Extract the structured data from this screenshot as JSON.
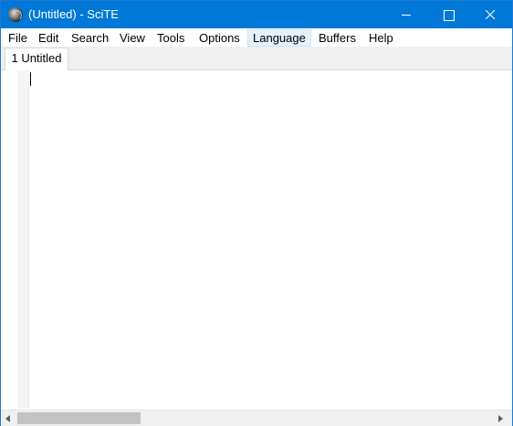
{
  "window": {
    "title": "(Untitled) - SciTE"
  },
  "menu": {
    "items": [
      "File",
      "Edit",
      "Search",
      "View",
      "Tools",
      "Options",
      "Language",
      "Buffers",
      "Help"
    ],
    "highlighted": "Language"
  },
  "tabs": [
    {
      "label": "1 Untitled",
      "active": true
    }
  ],
  "editor": {
    "content": ""
  },
  "icons": {
    "app": "scite-icon",
    "minimize": "minimize-icon",
    "maximize": "maximize-icon",
    "close": "close-icon",
    "scroll_left": "arrow-left-icon",
    "scroll_right": "arrow-right-icon"
  },
  "colors": {
    "titlebar": "#0078d7",
    "menu_hover": "#e5f1fb",
    "tabbar": "#f0f0f0"
  }
}
